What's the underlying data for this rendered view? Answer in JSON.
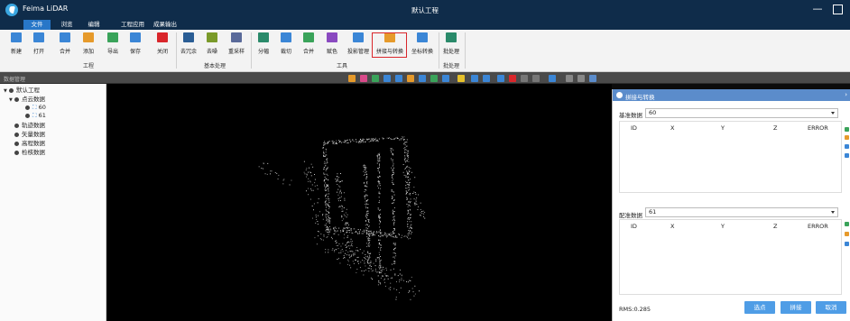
{
  "app": {
    "name": "Feima LiDAR",
    "window_title": "默认工程"
  },
  "menu": [
    "文件",
    "浏览",
    "编辑",
    "工程应用",
    "成果输出"
  ],
  "ribbon": {
    "tools": [
      {
        "label": "新建",
        "icon": "new-file-icon",
        "color": "#3b86d6"
      },
      {
        "label": "打开",
        "icon": "open-folder-icon",
        "color": "#3b86d6"
      },
      {
        "label": "合并",
        "icon": "merge-icon",
        "color": "#3b86d6"
      },
      {
        "label": "添加",
        "icon": "add-icon",
        "color": "#e69a2b"
      },
      {
        "label": "导出",
        "icon": "export-icon",
        "color": "#3aa35a"
      },
      {
        "label": "保存",
        "icon": "save-icon",
        "color": "#3b86d6"
      },
      {
        "label": "关闭",
        "icon": "close-icon",
        "color": "#d9262b"
      },
      {
        "label": "去冗余",
        "icon": "dedup-icon",
        "color": "#2a5d94"
      },
      {
        "label": "去噪",
        "icon": "denoise-icon",
        "color": "#7a9a2a"
      },
      {
        "label": "重采样",
        "icon": "resample-icon",
        "color": "#5a6a9a"
      },
      {
        "label": "分幅",
        "icon": "tile-icon",
        "color": "#2a8a6a"
      },
      {
        "label": "裁切",
        "icon": "clip-icon",
        "color": "#3b86d6"
      },
      {
        "label": "合并",
        "icon": "merge-icon",
        "color": "#3aa35a"
      },
      {
        "label": "赋色",
        "icon": "colorize-icon",
        "color": "#8a4ac0"
      },
      {
        "label": "投影管理",
        "icon": "projection-icon",
        "color": "#3b86d6"
      },
      {
        "label": "拼接与转换",
        "icon": "stitch-transform-icon",
        "color": "#e69a2b"
      },
      {
        "label": "坐标转换",
        "icon": "coordinate-transform-icon",
        "color": "#3b86d6"
      },
      {
        "label": "批处理",
        "icon": "batch-icon",
        "color": "#2a8a6a"
      }
    ],
    "groups": [
      "工程",
      "基本处理",
      "工具",
      "批处理"
    ]
  },
  "panel": {
    "title": "数据管理"
  },
  "tree": {
    "root": "默认工程",
    "items": [
      {
        "label": "点云数据"
      },
      {
        "label": "60"
      },
      {
        "label": "61"
      },
      {
        "label": "轨迹数据"
      },
      {
        "label": "矢量数据"
      },
      {
        "label": "高程数据"
      },
      {
        "label": "检核数据"
      }
    ]
  },
  "dialog": {
    "title": "拼接与转换",
    "base_label": "基准数据",
    "base_value": "60",
    "reg_label": "配准数据",
    "reg_value": "61",
    "columns": [
      "ID",
      "X",
      "Y",
      "Z",
      "ERROR"
    ],
    "rms": "RMS:0.285",
    "buttons": [
      "选点",
      "拼接",
      "取消"
    ]
  }
}
